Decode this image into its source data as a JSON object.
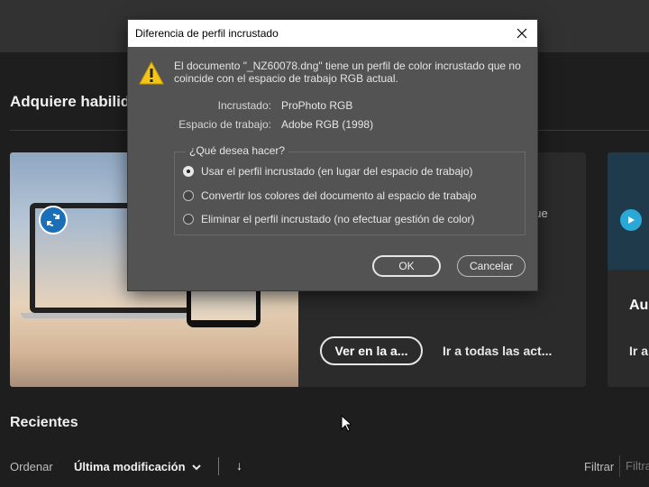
{
  "home": {
    "section_title": "Adquiere habilida",
    "main_card": {
      "description_fragment": "que",
      "primary_button": "Ver en la a...",
      "secondary_link": "Ir a todas las act..."
    },
    "right_card": {
      "title_fragment": "Au",
      "link_fragment": "Ir a"
    },
    "recent": {
      "title": "Recientes",
      "sort_label": "Ordenar",
      "sort_value": "Última modificación",
      "filter_label": "Filtrar",
      "filter_placeholder": "Filtra"
    }
  },
  "dialog": {
    "title": "Diferencia de perfil incrustado",
    "message": "El documento \"_NZ60078.dng\" tiene un perfil de color incrustado que no coincide con el espacio de trabajo RGB actual.",
    "embedded_label": "Incrustado:",
    "embedded_value": "ProPhoto RGB",
    "workspace_label": "Espacio de trabajo:",
    "workspace_value": "Adobe RGB (1998)",
    "question": "¿Qué desea hacer?",
    "options": [
      {
        "label": "Usar el perfil incrustado (en lugar del espacio de trabajo)",
        "checked": true
      },
      {
        "label": "Convertir los colores del documento al espacio de trabajo",
        "checked": false
      },
      {
        "label": "Eliminar el perfil incrustado (no efectuar gestión de color)",
        "checked": false
      }
    ],
    "ok_label": "OK",
    "cancel_label": "Cancelar"
  },
  "icons": [
    "warning-icon",
    "close-icon",
    "sync-icon",
    "play-icon",
    "chevron-down-icon",
    "arrow-down-icon",
    "mouse-cursor"
  ],
  "colors": {
    "background": "#1e1e1e",
    "dialog": "#535353",
    "warning": "#f5c518",
    "sync_badge": "#1b6fb8"
  }
}
